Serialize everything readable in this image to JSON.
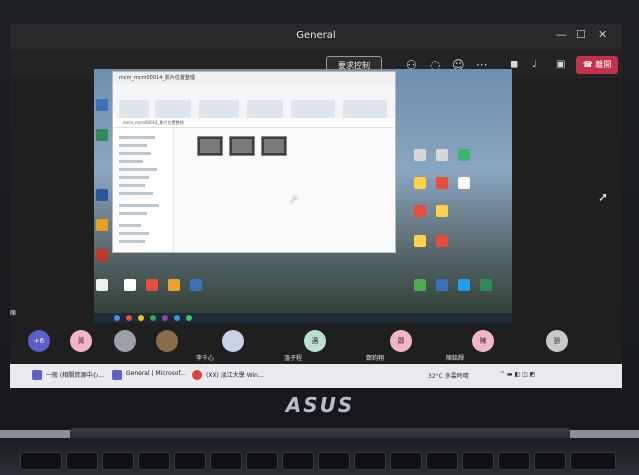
{
  "teams": {
    "window_title": "General",
    "request_control_label": "要求控制",
    "leave_label": "離開",
    "controls": {
      "minimize": "—",
      "maximize": "☐",
      "close": "✕"
    }
  },
  "shared_screen": {
    "explorer_title": "mcm_mcm00014_影片位置整理",
    "address": "mcm_mcm00014_影片位置整理"
  },
  "participants": {
    "overflow_count": "+6",
    "avatars": [
      {
        "initial": "黃",
        "color": "#f3b6c8"
      },
      {
        "initial": "",
        "color": "#9aa0a6"
      },
      {
        "initial": "",
        "color": "#8a6b4a"
      },
      {
        "initial": "",
        "color": "#c9d3e8"
      },
      {
        "initial": "邁",
        "color": "#b8e0d2"
      },
      {
        "initial": "鄭",
        "color": "#f1b6c0"
      },
      {
        "initial": "陳",
        "color": "#f3b6c8"
      },
      {
        "initial": "張",
        "color": "#c9c9c9"
      }
    ],
    "names": [
      {
        "text": "李千心"
      },
      {
        "text": "溫子程"
      },
      {
        "text": "鄭鈞翔"
      },
      {
        "text": "陳銘輝"
      }
    ],
    "left_name": "陳"
  },
  "windows_taskbar": {
    "items": [
      {
        "label": "一般 (相關資源中心..."
      },
      {
        "label": "General | Microsof..."
      },
      {
        "label": "(XX) 淡江大學 Win..."
      }
    ],
    "tray_temp": "32°C 多雲時晴",
    "brand_logo": "ASUS"
  }
}
